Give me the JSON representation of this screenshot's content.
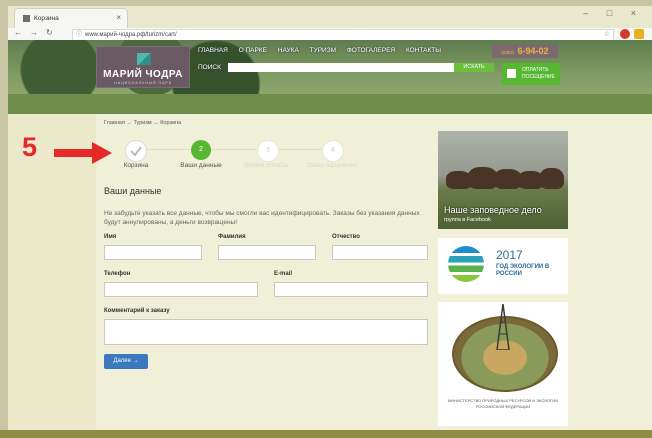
{
  "browser": {
    "tab_title": "Корзина",
    "url": "www.марий-чодра.рф/turizm/cart/",
    "window_controls": "–  □  ×"
  },
  "site": {
    "logo_text": "МАРИЙ ЧОДРА",
    "logo_subtitle": "НАЦИОНАЛЬНЫЙ ПАРК",
    "nav": [
      "ГЛАВНАЯ",
      "О ПАРКЕ",
      "НАУКА",
      "ТУРИЗМ",
      "ФОТОГАЛЕРЕЯ",
      "КОНТАКТЫ"
    ],
    "phone_prefix": "(8362)",
    "phone": "6-94-02",
    "search_label": "ПОИСК",
    "search_button": "ИСКАТЬ",
    "pay_button": "ОПЛАТИТЬ ПОСЕЩЕНИЕ"
  },
  "breadcrumb": "Главная → Туризм → Корзина",
  "annotation_number": "5",
  "steps": [
    {
      "label": "Корзина",
      "state": "done",
      "icon": "check-icon"
    },
    {
      "label": "Ваши данные",
      "state": "active",
      "number": "2"
    },
    {
      "label": "Форма оплаты",
      "state": "pending",
      "number": "3"
    },
    {
      "label": "Заказ оформлен",
      "state": "pending",
      "number": "4"
    }
  ],
  "form": {
    "heading": "Ваши данные",
    "warning": "Не забудьте указать все данные, чтобы мы смогли вас идентифицировать. Заказы без указания данных будут аннулированы, а деньги возвращены!",
    "labels": {
      "first_name": "Имя",
      "last_name": "Фамилия",
      "patronymic": "Отчество",
      "phone": "Телефон",
      "email": "E-mail",
      "comment": "Комментарий к заказу"
    },
    "submit": "Далее →"
  },
  "sidebar": {
    "promo1_title": "Наше заповедное дело",
    "promo1_sub": "группа в Facebook",
    "eco_year": "2017",
    "eco_text": "ГОД ЭКОЛОГИИ В РОССИИ",
    "ministry_text": "МИНИСТЕРСТВО ПРИРОДНЫХ РЕСУРСОВ И ЭКОЛОГИИ РОССИЙСКОЙ ФЕДЕРАЦИИ"
  },
  "colors": {
    "accent_green": "#58b732",
    "button_blue": "#3a78c0",
    "annotation_red": "#e32a28",
    "phone_orange": "#e8b048"
  }
}
